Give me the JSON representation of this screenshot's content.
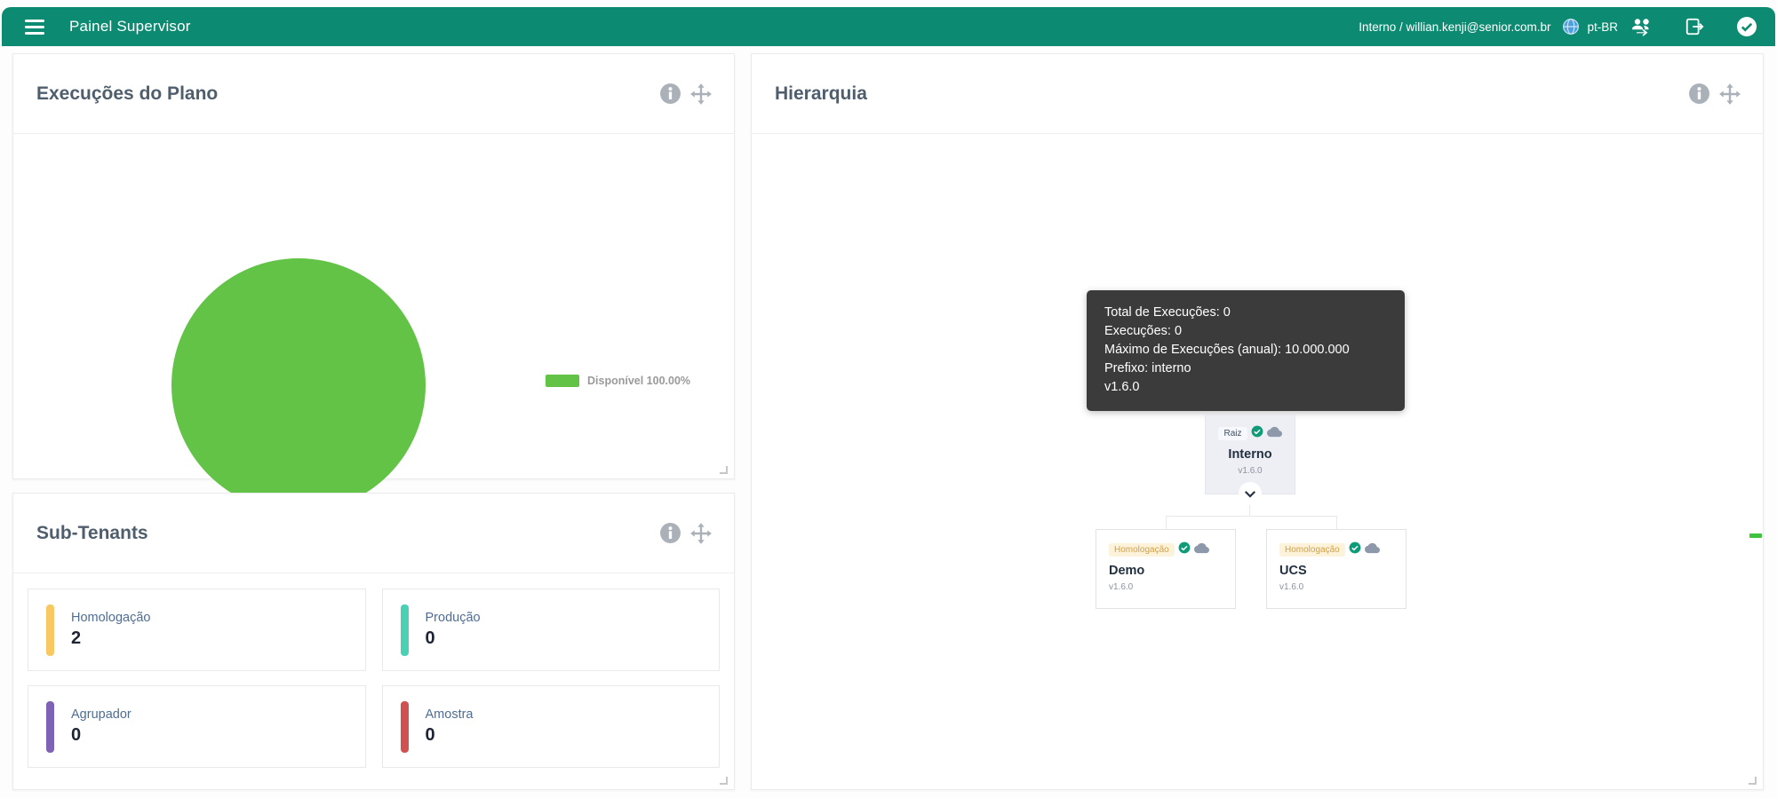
{
  "header": {
    "title": "Painel Supervisor",
    "user": "Interno / willian.kenji@senior.com.br",
    "locale": "pt-BR",
    "accent_color": "#0d8b72"
  },
  "panels": {
    "executions": {
      "title": "Execuções do Plano",
      "legend_label": "Disponível 100.00%"
    },
    "subtenants": {
      "title": "Sub-Tenants",
      "cards": [
        {
          "label": "Homologação",
          "value": "2",
          "color": "#f8c863"
        },
        {
          "label": "Produção",
          "value": "0",
          "color": "#4ad0b5"
        },
        {
          "label": "Agrupador",
          "value": "0",
          "color": "#7e62b6"
        },
        {
          "label": "Amostra",
          "value": "0",
          "color": "#cf5250"
        }
      ]
    },
    "hierarchy": {
      "title": "Hierarquia",
      "tooltip": {
        "lines": [
          "Total de Execuções: 0",
          "Execuções: 0",
          "Máximo de Execuções (anual): 10.000.000",
          "Prefixo: interno",
          "v1.6.0"
        ]
      },
      "root": {
        "badge": "Raiz",
        "name": "Interno",
        "version": "v1.6.0"
      },
      "children": [
        {
          "badge": "Homologação",
          "name": "Demo",
          "version": "v1.6.0"
        },
        {
          "badge": "Homologação",
          "name": "UCS",
          "version": "v1.6.0"
        }
      ]
    }
  },
  "chart_data": {
    "type": "pie",
    "title": "Execuções do Plano",
    "slices": [
      {
        "label": "Disponível",
        "value": 100.0,
        "color": "#62c346"
      }
    ],
    "legend": [
      "Disponível 100.00%"
    ],
    "legend_position": "right"
  }
}
